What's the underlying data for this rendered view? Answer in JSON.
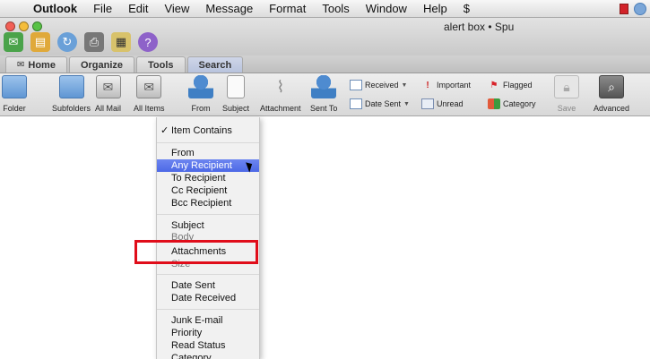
{
  "menubar": {
    "app": "Outlook",
    "items": [
      "File",
      "Edit",
      "View",
      "Message",
      "Format",
      "Tools",
      "Window",
      "Help"
    ],
    "script_glyph": "$"
  },
  "window": {
    "title": "alert box • Spu"
  },
  "tabs": [
    {
      "label": "Home",
      "active": false
    },
    {
      "label": "Organize",
      "active": false
    },
    {
      "label": "Tools",
      "active": false
    },
    {
      "label": "Search",
      "active": true
    }
  ],
  "ribbon": {
    "folder": "Folder",
    "subfolders": "Subfolders",
    "all_mail": "All Mail",
    "all_items": "All Items",
    "from": "From",
    "subject": "Subject",
    "attachment": "Attachment",
    "sent_to": "Sent To",
    "received": "Received",
    "date_sent": "Date Sent",
    "important": "Important",
    "unread": "Unread",
    "flagged": "Flagged",
    "category": "Category",
    "save": "Save",
    "advanced": "Advanced"
  },
  "dropdown": {
    "check_mark": "✓",
    "items": {
      "item_contains": "Item Contains",
      "from": "From",
      "any_recipient": "Any Recipient",
      "to_recipient": "To Recipient",
      "cc_recipient": "Cc Recipient",
      "bcc_recipient": "Bcc Recipient",
      "subject": "Subject",
      "body": "Body",
      "attachments": "Attachments",
      "size": "Size",
      "date_sent": "Date Sent",
      "date_received": "Date Received",
      "junk_email": "Junk E-mail",
      "priority": "Priority",
      "read_status": "Read Status",
      "category": "Category"
    },
    "highlighted": "Any Recipient",
    "checked": "Item Contains"
  },
  "annotation": {
    "color": "#e00d1a"
  }
}
